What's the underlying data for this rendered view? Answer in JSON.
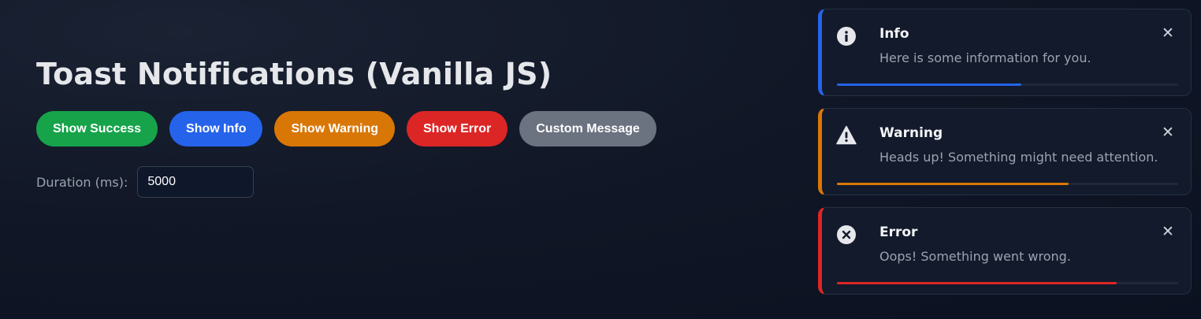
{
  "page": {
    "title": "Toast Notifications (Vanilla JS)"
  },
  "buttons": [
    {
      "label": "Show Success",
      "color": "#16a34a"
    },
    {
      "label": "Show Info",
      "color": "#2563eb"
    },
    {
      "label": "Show Warning",
      "color": "#d97706"
    },
    {
      "label": "Show Error",
      "color": "#dc2626"
    },
    {
      "label": "Custom Message",
      "color": "#6b7280"
    }
  ],
  "duration": {
    "label": "Duration (ms):",
    "value": "5000"
  },
  "toasts": [
    {
      "type": "info",
      "icon": "info-icon",
      "title": "Info",
      "message": "Here is some information for you.",
      "close_glyph": "✕",
      "accent": "#2563eb",
      "progress": 0.54
    },
    {
      "type": "warning",
      "icon": "warning-icon",
      "title": "Warning",
      "message": "Heads up! Something might need attention.",
      "close_glyph": "✕",
      "accent": "#d97706",
      "progress": 0.68
    },
    {
      "type": "error",
      "icon": "error-icon",
      "title": "Error",
      "message": "Oops! Something went wrong.",
      "close_glyph": "✕",
      "accent": "#dc2626",
      "progress": 0.82
    }
  ]
}
